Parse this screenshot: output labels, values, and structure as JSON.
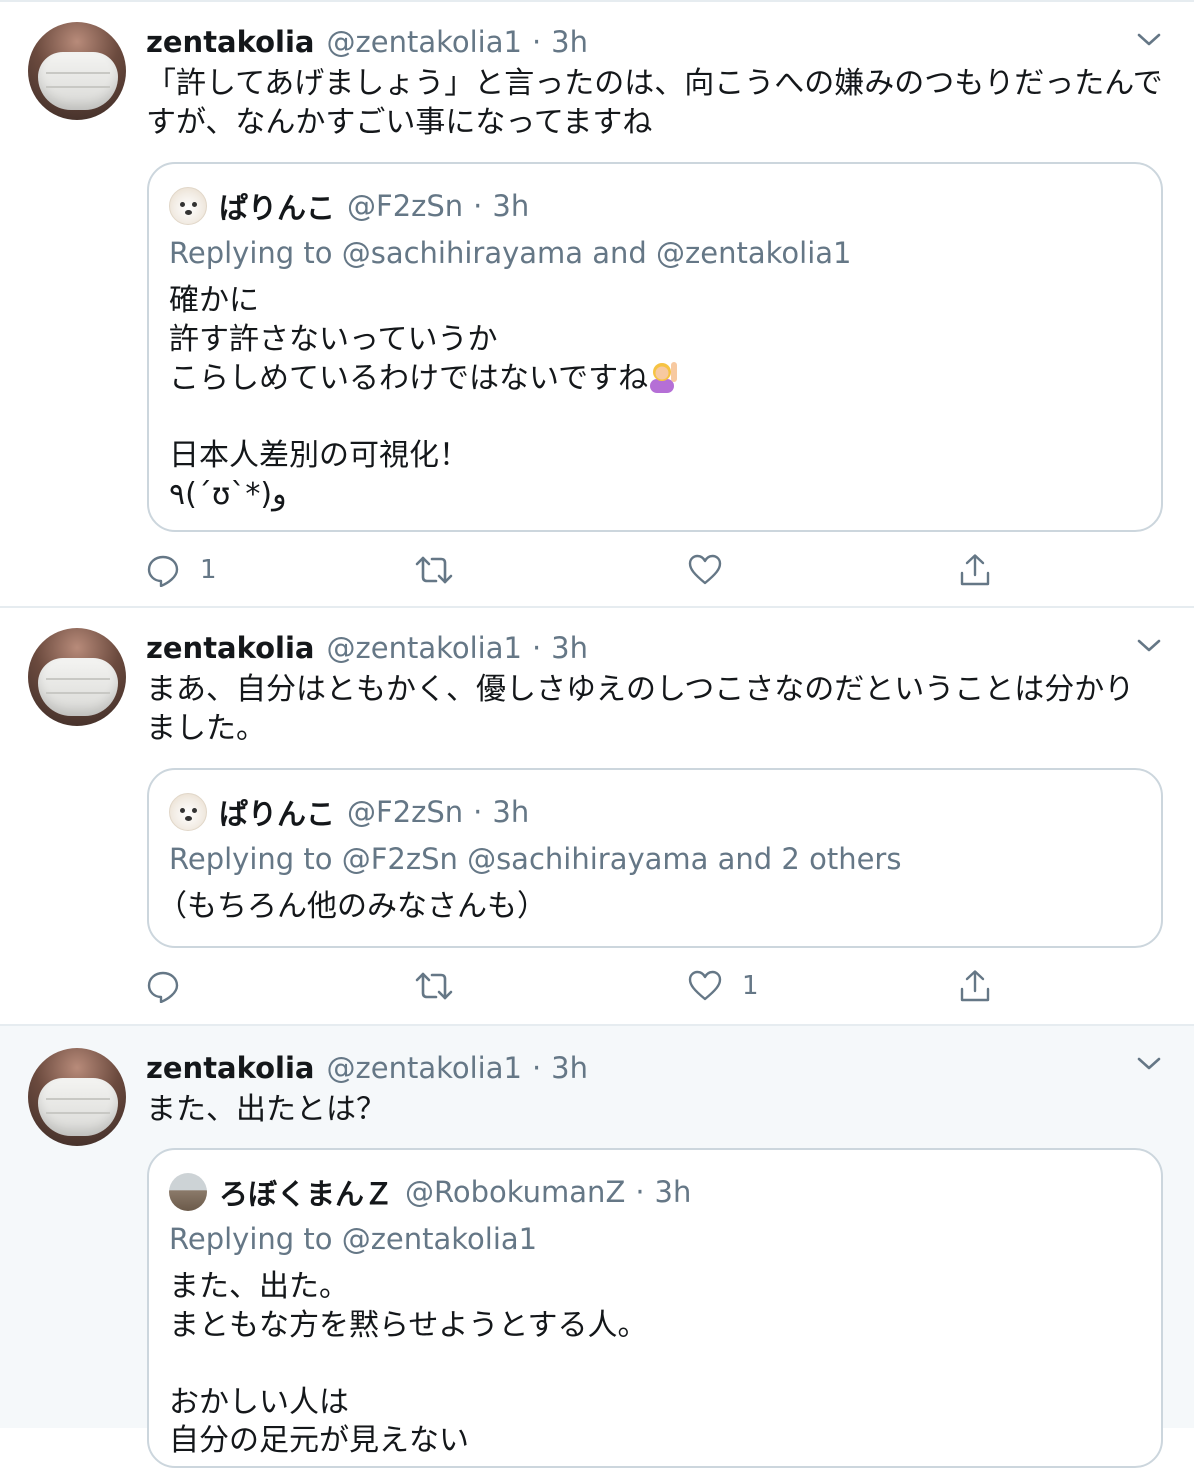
{
  "tweets": [
    {
      "name": "zentakolia",
      "handle": "@zentakolia1",
      "separator": "·",
      "time": "3h",
      "text": "「許してあげましょう」と言ったのは、向こうへの嫌みのつもりだったんで\nすが、なんかすごい事になってますね",
      "quote": {
        "name": "ぱりんこ",
        "handle": "@F2zSn",
        "separator": "·",
        "time": "3h",
        "replying": "Replying to @sachihirayama and @zentakolia1",
        "text_before_emoji": "確かに\n許す許さないっていうか\nこらしめているわけではないですね",
        "text_after_emoji": "\n\n日本人差別の可視化！\n٩(´ʊ`*)و"
      },
      "actions": {
        "reply_count": "1",
        "retweet_count": "",
        "like_count": ""
      }
    },
    {
      "name": "zentakolia",
      "handle": "@zentakolia1",
      "separator": "·",
      "time": "3h",
      "text": "まあ、自分はともかく、優しさゆえのしつこさなのだということは分かり\nました。",
      "quote": {
        "name": "ぱりんこ",
        "handle": "@F2zSn",
        "separator": "·",
        "time": "3h",
        "replying": "Replying to @F2zSn @sachihirayama and 2 others",
        "text": "（もちろん他のみなさんも）"
      },
      "actions": {
        "reply_count": "",
        "retweet_count": "",
        "like_count": "1"
      }
    },
    {
      "name": "zentakolia",
      "handle": "@zentakolia1",
      "separator": "·",
      "time": "3h",
      "text": "また、出たとは？",
      "quote": {
        "name": "ろぼくまんＺ",
        "handle": "@RobokumanZ",
        "separator": "·",
        "time": "3h",
        "replying": "Replying to @zentakolia1",
        "text": "また、出た。\nまともな方を黙らせようとする人。\n\nおかしい人は\n自分の足元が見えない"
      }
    }
  ],
  "icons": {
    "menu": "chevron-down-icon",
    "reply": "reply-icon",
    "retweet": "retweet-icon",
    "like": "heart-icon",
    "share": "share-icon",
    "emoji": "person-raising-hand-emoji"
  },
  "colors": {
    "secondary_text": "#657786",
    "border": "#ccd6dd",
    "highlight_bg": "#f5f8fa"
  }
}
